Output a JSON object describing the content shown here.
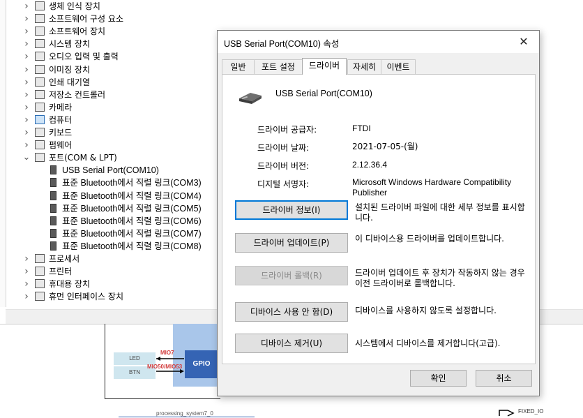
{
  "device_manager": {
    "categories": [
      {
        "label": "생체 인식 장치",
        "icon": "fingerprint-icon",
        "expanded": false
      },
      {
        "label": "소프트웨어 구성 요소",
        "icon": "component-icon",
        "expanded": false
      },
      {
        "label": "소프트웨어 장치",
        "icon": "software-device-icon",
        "expanded": false
      },
      {
        "label": "시스템 장치",
        "icon": "system-device-icon",
        "expanded": false
      },
      {
        "label": "오디오 입력 및 출력",
        "icon": "speaker-icon",
        "expanded": false
      },
      {
        "label": "이미징 장치",
        "icon": "camera-icon",
        "expanded": false
      },
      {
        "label": "인쇄 대기열",
        "icon": "printer-queue-icon",
        "expanded": false
      },
      {
        "label": "저장소 컨트롤러",
        "icon": "storage-controller-icon",
        "expanded": false
      },
      {
        "label": "카메라",
        "icon": "webcam-icon",
        "expanded": false
      },
      {
        "label": "컴퓨터",
        "icon": "monitor-icon",
        "expanded": false
      },
      {
        "label": "키보드",
        "icon": "keyboard-icon",
        "expanded": false
      },
      {
        "label": "펌웨어",
        "icon": "firmware-icon",
        "expanded": false
      },
      {
        "label": "포트(COM & LPT)",
        "icon": "port-icon",
        "expanded": true
      }
    ],
    "ports": [
      "USB Serial Port(COM10)",
      "표준 Bluetooth에서 직렬 링크(COM3)",
      "표준 Bluetooth에서 직렬 링크(COM4)",
      "표준 Bluetooth에서 직렬 링크(COM5)",
      "표준 Bluetooth에서 직렬 링크(COM6)",
      "표준 Bluetooth에서 직렬 링크(COM7)",
      "표준 Bluetooth에서 직렬 링크(COM8)"
    ],
    "categories_after": [
      {
        "label": "프로세서",
        "icon": "processor-icon"
      },
      {
        "label": "프린터",
        "icon": "printer-icon"
      },
      {
        "label": "휴대용 장치",
        "icon": "portable-device-icon"
      },
      {
        "label": "휴먼 인터페이스 장치",
        "icon": "hid-icon"
      }
    ]
  },
  "schematic": {
    "led": "LED",
    "btn": "BTN",
    "mio7": "MIO7",
    "mio": "MIO50/MIO53",
    "gpio": "GPIO",
    "processing": "processing_system7_0",
    "fixed_io": "FIXED_IO"
  },
  "dialog": {
    "title": "USB Serial Port(COM10) 속성",
    "close_glyph": "✕",
    "tabs": [
      "일반",
      "포트 설정",
      "드라이버",
      "자세히",
      "이벤트"
    ],
    "active_tab": 2,
    "device_name": "USB Serial Port(COM10)",
    "props": [
      {
        "label": "드라이버 공급자:",
        "value": "FTDI"
      },
      {
        "label": "드라이버 날짜:",
        "value": "2021-07-05-(월)"
      },
      {
        "label": "드라이버 버전:",
        "value": "2.12.36.4"
      },
      {
        "label": "디지털 서명자:",
        "value": "Microsoft Windows Hardware Compatibility Publisher"
      }
    ],
    "actions": [
      {
        "label": "드라이버 정보(I)",
        "desc": "설치된 드라이버 파일에 대한 세부 정보를 표시합니다.",
        "enabled": true,
        "default": true
      },
      {
        "label": "드라이버 업데이트(P)",
        "desc": "이 디바이스용 드라이버를 업데이트합니다.",
        "enabled": true,
        "default": false
      },
      {
        "label": "드라이버 롤백(R)",
        "desc": "드라이버 업데이트 후 장치가 작동하지 않는 경우 이전 드라이버로 롤백합니다.",
        "enabled": false,
        "default": false
      },
      {
        "label": "디바이스 사용 안 함(D)",
        "desc": "디바이스를 사용하지 않도록 설정합니다.",
        "enabled": true,
        "default": false
      },
      {
        "label": "디바이스 제거(U)",
        "desc": "시스템에서 디바이스를 제거합니다(고급).",
        "enabled": true,
        "default": false
      }
    ],
    "ok": "확인",
    "cancel": "취소",
    "accent": "#0078d7"
  }
}
